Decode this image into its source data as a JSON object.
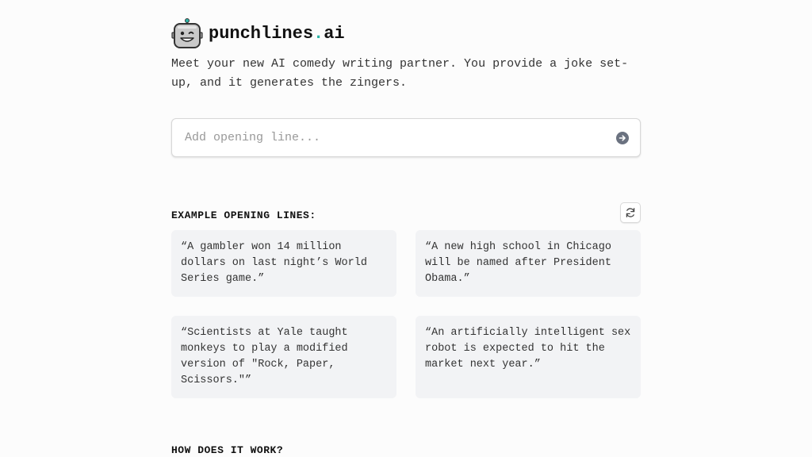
{
  "brand": {
    "name_main": "punchlines",
    "name_dot": ".",
    "name_tld": "ai",
    "logo_icon": "robot-face-icon"
  },
  "tagline": "Meet your new AI comedy writing partner. You provide a joke set-up, and it generates the zingers.",
  "input": {
    "placeholder": "Add opening line...",
    "value": ""
  },
  "examples": {
    "title": "EXAMPLE OPENING LINES:",
    "refresh_icon": "refresh-icon",
    "items": [
      "“A gambler won 14 million dollars on last night’s World Series game.”",
      "“A new high school in Chicago will be named after President Obama.”",
      "“Scientists at Yale taught monkeys to play a modified version of \"Rock, Paper, Scissors.\"”",
      "“An artificially intelligent sex robot is expected to hit the market next year.”"
    ]
  },
  "how_it_works": {
    "title": "HOW DOES IT WORK?"
  },
  "colors": {
    "accent": "#2bb3a6",
    "card_bg": "#f2f3f5",
    "submit_bg": "#6b7280"
  }
}
